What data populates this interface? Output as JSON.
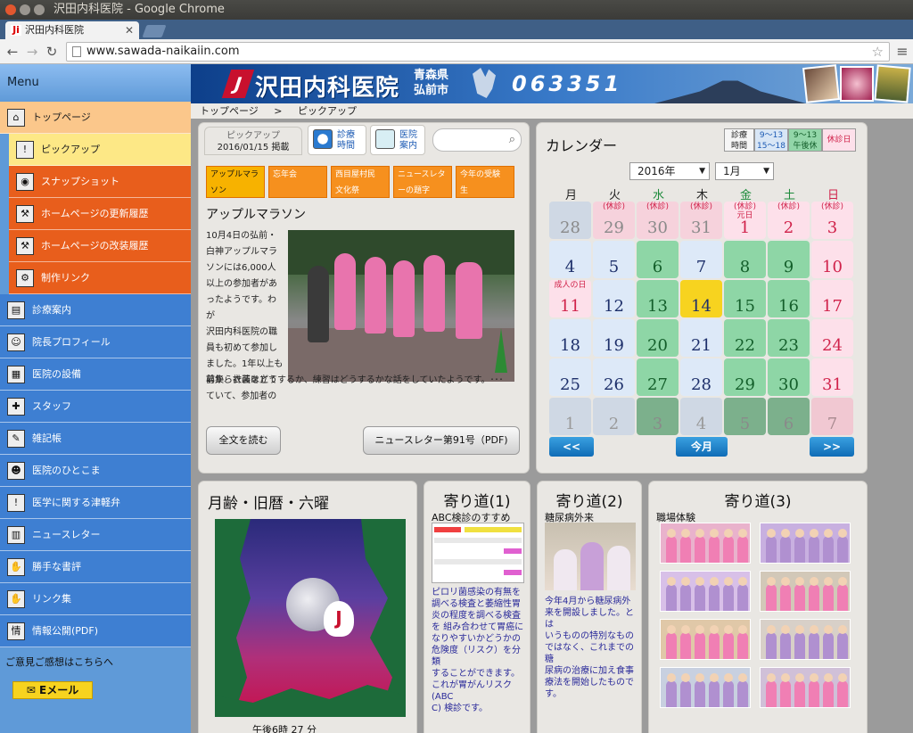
{
  "window": {
    "title": "沢田内科医院 - Google Chrome"
  },
  "tab": {
    "title": "沢田内科医院",
    "favicon": "Ji"
  },
  "address": {
    "url": "www.sawada-naikaiin.com"
  },
  "sidebar": {
    "heading": "Menu",
    "items": [
      {
        "label": "トップページ",
        "icon": "home-icon",
        "glyph": "⌂"
      },
      {
        "label": "ピックアップ",
        "icon": "pickup-icon",
        "glyph": "!"
      },
      {
        "label": "スナップショット",
        "icon": "camera-icon",
        "glyph": "◉"
      },
      {
        "label": "ホームページの更新履歴",
        "icon": "hammer-icon",
        "glyph": "⚒"
      },
      {
        "label": "ホームページの改装履歴",
        "icon": "hammer-icon",
        "glyph": "⚒"
      },
      {
        "label": "制作リンク",
        "icon": "gear-icon",
        "glyph": "⚙"
      },
      {
        "label": "診療案内",
        "icon": "car-icon",
        "glyph": "▤"
      },
      {
        "label": "院長プロフィール",
        "icon": "doctor-icon",
        "glyph": "☺"
      },
      {
        "label": "医院の設備",
        "icon": "equipment-icon",
        "glyph": "▦"
      },
      {
        "label": "スタッフ",
        "icon": "nurse-icon",
        "glyph": "✚"
      },
      {
        "label": "雑記帳",
        "icon": "notebook-icon",
        "glyph": "✎"
      },
      {
        "label": "医院のひとこま",
        "icon": "scene-icon",
        "glyph": "☻"
      },
      {
        "label": "医学に関する津軽弁",
        "icon": "exclamation-icon",
        "glyph": "!"
      },
      {
        "label": "ニュースレター",
        "icon": "building-icon",
        "glyph": "▥"
      },
      {
        "label": "勝手な書評",
        "icon": "book-icon",
        "glyph": "✋"
      },
      {
        "label": "リンク集",
        "icon": "handshake-icon",
        "glyph": "✋"
      },
      {
        "label": "情報公開(PDF)",
        "icon": "info-icon",
        "glyph": "情"
      }
    ],
    "feedback": "ご意見ご感想はこちらへ",
    "email_label": "Eメール"
  },
  "header": {
    "site_name": "沢田内科医院",
    "pref_line1": "青森県",
    "pref_line2": "弘前市",
    "phone": "063351"
  },
  "breadcrumb": {
    "home": "トップページ",
    "sep": ">",
    "current": "ピックアップ"
  },
  "pickup": {
    "label": "ピックアップ",
    "date": "2016/01/15 掲載",
    "link1_line1": "診療",
    "link1_line2": "時間",
    "link2_line1": "医院",
    "link2_line2": "案内",
    "tabs": [
      {
        "line1": "アップルマラ",
        "line2": "ソン"
      },
      {
        "line1": "忘年会",
        "line2": ""
      },
      {
        "line1": "西目屋村民",
        "line2": "文化祭"
      },
      {
        "line1": "ニュースレタ",
        "line2": "ーの題字"
      },
      {
        "line1": "今年の受験",
        "line2": "生"
      }
    ],
    "title": "アップルマラソン",
    "text_lines": [
      "10月4日の弘前・",
      "白神アップルマラ",
      "ソンには6,000人",
      "以上の参加者があ",
      "ったようです。わが",
      "沢田内科医院の職",
      "員も初めて参加し",
      "ました。1年以上も",
      "前から計画を立て",
      "ていて、参加者の"
    ],
    "text_full": "募集、衣装はどうするか、練習はどうするかな話をしていたようです。･･･",
    "read_more": "全文を読む",
    "newsletter_btn": "ニュースレター第91号（PDF)"
  },
  "calendar": {
    "title": "カレンダー",
    "legend": {
      "hours_label_1": "診療",
      "hours_label_2": "時間",
      "weekday_1": "9～13",
      "weekday_2": "15～18",
      "half_1": "9～13",
      "half_2": "午後休",
      "closed": "休診日"
    },
    "year": "2016年",
    "month": "1月",
    "weekdays": [
      "月",
      "火",
      "水",
      "木",
      "金",
      "土",
      "日"
    ],
    "weekday_colors": [
      "#222222",
      "#222222",
      "#1c8a3a",
      "#222222",
      "#1c8a3a",
      "#1c8a3a",
      "#d0224a"
    ],
    "weeks": [
      [
        {
          "d": "28",
          "t": "prev"
        },
        {
          "d": "29",
          "t": "prevhol",
          "n": "(休診)"
        },
        {
          "d": "30",
          "t": "prevhol",
          "n": "(休診)"
        },
        {
          "d": "31",
          "t": "prevhol",
          "n": "(休診)"
        },
        {
          "d": "1",
          "t": "hol",
          "n": "(休診)",
          "n2": "元日"
        },
        {
          "d": "2",
          "t": "hol",
          "n": "(休診)"
        },
        {
          "d": "3",
          "t": "hol",
          "n": "(休診)"
        }
      ],
      [
        {
          "d": "4",
          "t": "wd"
        },
        {
          "d": "5",
          "t": "wd"
        },
        {
          "d": "6",
          "t": "half"
        },
        {
          "d": "7",
          "t": "wd"
        },
        {
          "d": "8",
          "t": "half"
        },
        {
          "d": "9",
          "t": "half"
        },
        {
          "d": "10",
          "t": "hol"
        }
      ],
      [
        {
          "d": "11",
          "t": "hol",
          "n": "成人の日"
        },
        {
          "d": "12",
          "t": "wd"
        },
        {
          "d": "13",
          "t": "half"
        },
        {
          "d": "14",
          "t": "today"
        },
        {
          "d": "15",
          "t": "half"
        },
        {
          "d": "16",
          "t": "half"
        },
        {
          "d": "17",
          "t": "hol"
        }
      ],
      [
        {
          "d": "18",
          "t": "wd"
        },
        {
          "d": "19",
          "t": "wd"
        },
        {
          "d": "20",
          "t": "half"
        },
        {
          "d": "21",
          "t": "wd"
        },
        {
          "d": "22",
          "t": "half"
        },
        {
          "d": "23",
          "t": "half"
        },
        {
          "d": "24",
          "t": "hol"
        }
      ],
      [
        {
          "d": "25",
          "t": "wd"
        },
        {
          "d": "26",
          "t": "wd"
        },
        {
          "d": "27",
          "t": "half"
        },
        {
          "d": "28",
          "t": "wd"
        },
        {
          "d": "29",
          "t": "half"
        },
        {
          "d": "30",
          "t": "half"
        },
        {
          "d": "31",
          "t": "hol"
        }
      ],
      [
        {
          "d": "1",
          "t": "next"
        },
        {
          "d": "2",
          "t": "next"
        },
        {
          "d": "3",
          "t": "nexthalf"
        },
        {
          "d": "4",
          "t": "next"
        },
        {
          "d": "5",
          "t": "nexthalf"
        },
        {
          "d": "6",
          "t": "nexthalf"
        },
        {
          "d": "7",
          "t": "nexthol"
        }
      ]
    ],
    "prev": "<<",
    "today": "今月",
    "next": ">>"
  },
  "moon": {
    "title": "月齢・旧暦・六曜",
    "time": "午後6時 27 分"
  },
  "yorimichi1": {
    "title": "寄り道(1)",
    "subtitle": "ABC検診のすすめ",
    "body": [
      "ピロリ菌感染の有無を",
      "調べる検査と萎縮性胃",
      "炎の程度を調べる検査",
      "を 組み合わせて胃癌に",
      "なりやすいかどうかの",
      "危険度（リスク）を分類",
      "することができます。",
      "これが胃がんリスク(ABC",
      "C) 検診です。"
    ]
  },
  "yorimichi2": {
    "title": "寄り道(2)",
    "subtitle": "糖尿病外来",
    "body": [
      "今年4月から糖尿病外",
      "来を開設しました。とは",
      "いうものの特別なもの",
      "ではなく、これまでの糖",
      "尿病の治療に加え食事",
      "療法を開始したもので",
      "す。"
    ]
  },
  "yorimichi3": {
    "title": "寄り道(3)",
    "subtitle": "職場体験"
  }
}
